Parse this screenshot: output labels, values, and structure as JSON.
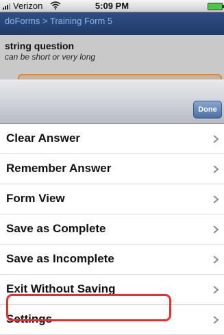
{
  "status_bar": {
    "carrier": "Verizon",
    "time": "5:09 PM",
    "battery_color": "#4ac940",
    "icons": [
      "signal-bars-icon",
      "wifi-icon",
      "battery-icon"
    ]
  },
  "nav": {
    "breadcrumb": "doForms > Training Form 5"
  },
  "question": {
    "label": "string question",
    "hint": "can be short or very long",
    "value": ""
  },
  "sheet": {
    "done_label": "Done"
  },
  "menu": {
    "items": [
      {
        "label": "Clear Answer",
        "icon": "chevron-right-icon"
      },
      {
        "label": "Remember Answer",
        "icon": "chevron-right-icon"
      },
      {
        "label": "Form View",
        "icon": "chevron-right-icon"
      },
      {
        "label": "Save as Complete",
        "icon": "chevron-right-icon"
      },
      {
        "label": "Save as Incomplete",
        "icon": "chevron-right-icon"
      },
      {
        "label": "Exit Without Saving",
        "icon": "chevron-right-icon",
        "highlighted": true
      },
      {
        "label": "Settings",
        "icon": "chevron-right-icon"
      }
    ]
  },
  "colors": {
    "nav_background": "#1f3a68",
    "nav_text": "#8fb4e6",
    "highlight": "#e53030",
    "input_border": "#d98a3a",
    "done_button": "#4b6fa6"
  }
}
